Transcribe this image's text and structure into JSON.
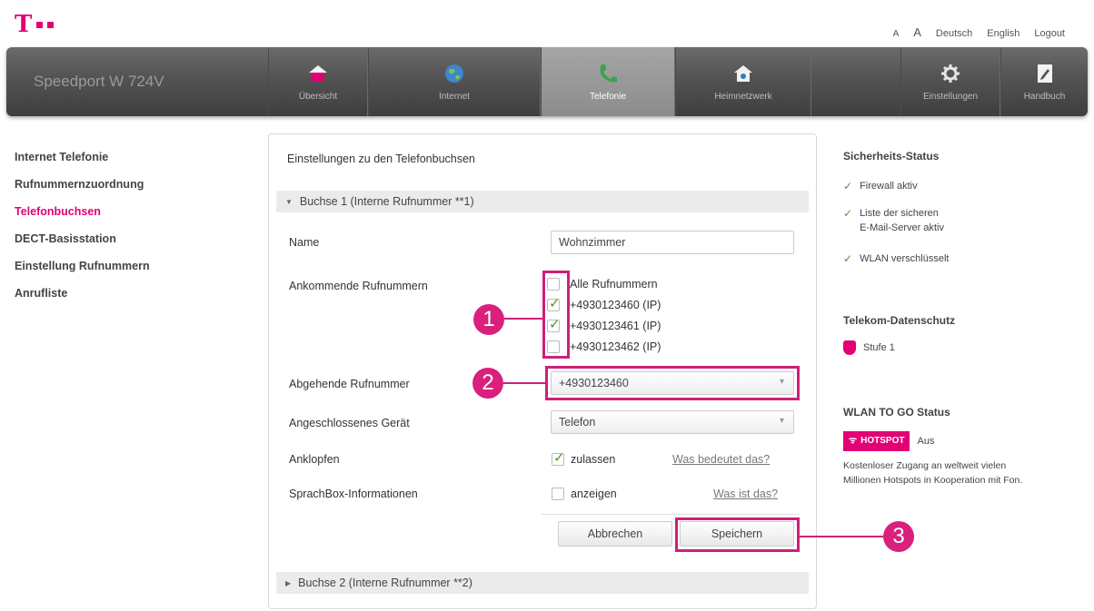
{
  "header": {
    "logo_letter": "T",
    "font_small": "A",
    "font_large": "A",
    "lang_de": "Deutsch",
    "lang_en": "English",
    "logout": "Logout"
  },
  "nav": {
    "brand": "Speedport W 724V",
    "items": [
      {
        "label": "Übersicht",
        "icon": "house-icon"
      },
      {
        "label": "Internet",
        "icon": "globe-icon"
      },
      {
        "label": "Telefonie",
        "icon": "phone-icon",
        "active": true
      },
      {
        "label": "Heimnetzwerk",
        "icon": "home-network-icon"
      },
      {
        "label": "Einstellungen",
        "icon": "gear-icon"
      },
      {
        "label": "Handbuch",
        "icon": "manual-icon"
      }
    ]
  },
  "leftmenu": [
    "Internet Telefonie",
    "Rufnummernzuordnung",
    "Telefonbuchsen",
    "DECT-Basisstation",
    "Einstellung Rufnummern",
    "Anrufliste"
  ],
  "panel": {
    "title": "Einstellungen zu den Telefonbuchsen",
    "section1": "Buchse 1 (Interne Rufnummer **1)",
    "section2": "Buchse 2 (Interne Rufnummer **2)",
    "name_label": "Name",
    "name_value": "Wohnzimmer",
    "incoming_label": "Ankommende Rufnummern",
    "incoming": [
      {
        "label": "Alle Rufnummern",
        "checked": false
      },
      {
        "label": "+4930123460 (IP)",
        "checked": true
      },
      {
        "label": "+4930123461 (IP)",
        "checked": true
      },
      {
        "label": "+4930123462 (IP)",
        "checked": false
      }
    ],
    "outgoing_label": "Abgehende Rufnummer",
    "outgoing_value": "+4930123460",
    "device_label": "Angeschlossenes Gerät",
    "device_value": "Telefon",
    "knock_label": "Anklopfen",
    "knock_option": "zulassen",
    "knock_link": "Was bedeutet das?",
    "sprachbox_label": "SprachBox-Informationen",
    "sprachbox_option": "anzeigen",
    "sprachbox_link": "Was ist das?",
    "cancel": "Abbrechen",
    "save": "Speichern"
  },
  "annotations": [
    "1",
    "2",
    "3"
  ],
  "right": {
    "security_title": "Sicherheits-Status",
    "firewall": "Firewall aktiv",
    "mail_line1": "Liste der sicheren",
    "mail_line2": "E-Mail-Server aktiv",
    "wlan": "WLAN verschlüsselt",
    "privacy_title": "Telekom-Datenschutz",
    "level": "Stufe 1",
    "wlan_to_go_title": "WLAN TO GO Status",
    "hotspot": "HOTSPOT",
    "hotspot_status": "Aus",
    "hotspot_desc1": "Kostenloser Zugang an weltweit vielen",
    "hotspot_desc2": "Millionen Hotspots in Kooperation mit Fon."
  },
  "colors": {
    "magenta": "#e20074",
    "check_green": "#4d9a1f",
    "annotation": "#cf1f7a"
  }
}
